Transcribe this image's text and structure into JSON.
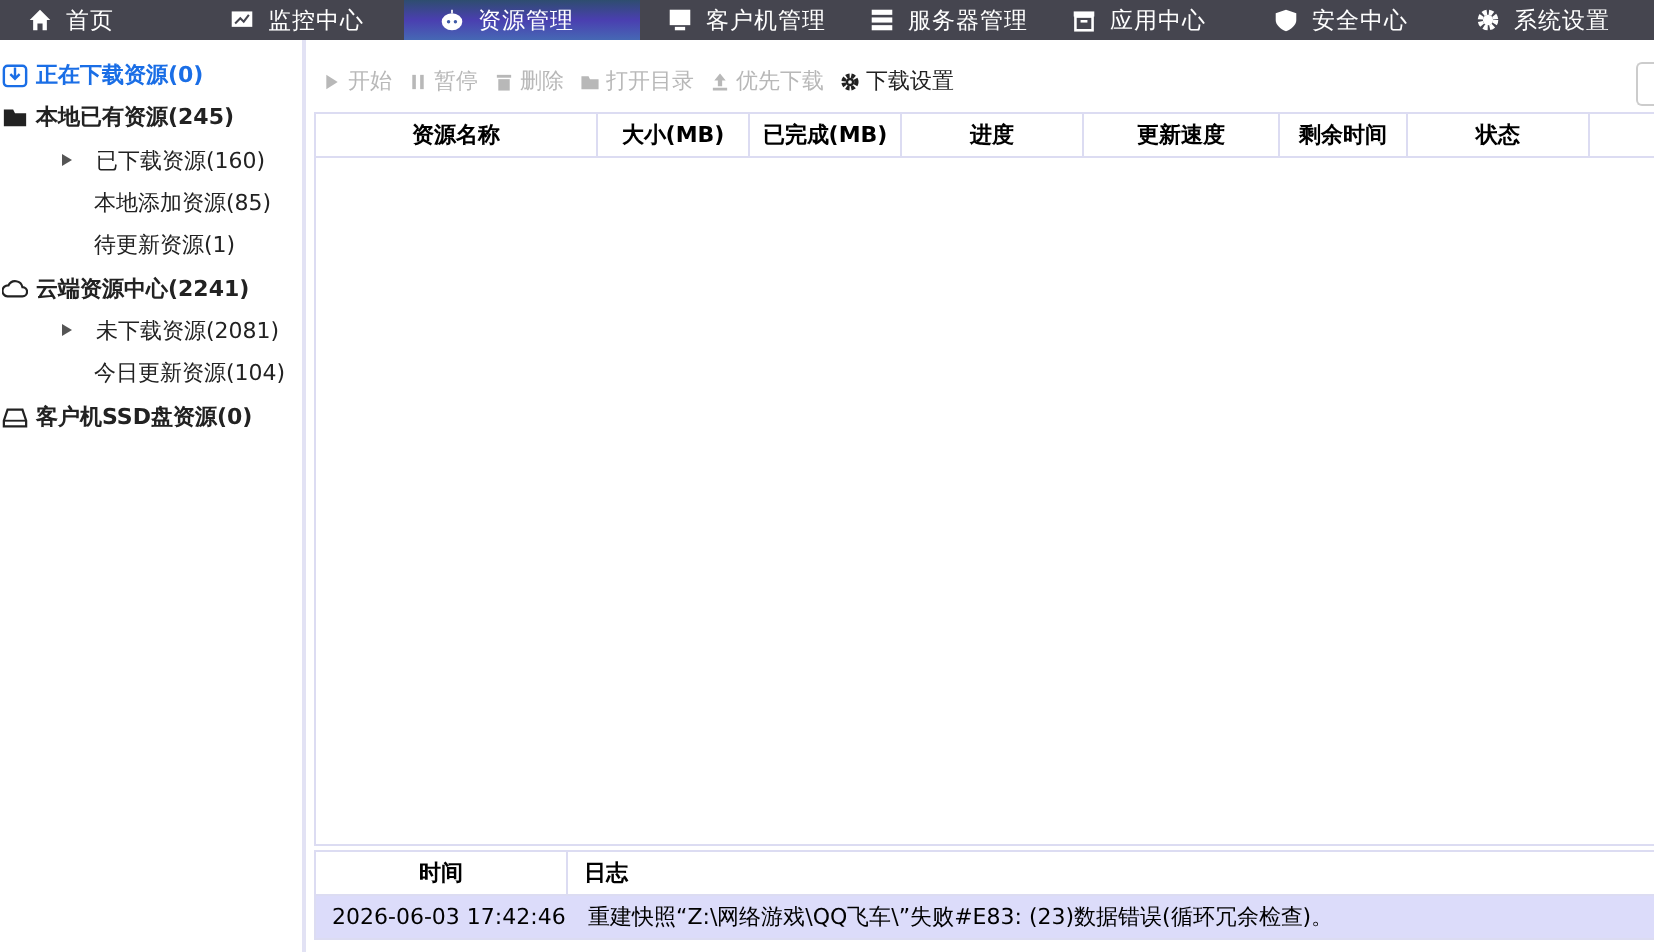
{
  "nav": {
    "tabs": [
      {
        "label": "首页",
        "kind": "home",
        "selected": false
      },
      {
        "label": "监控中心",
        "kind": "monitor",
        "selected": false
      },
      {
        "label": "资源管理",
        "kind": "robot",
        "selected": true
      },
      {
        "label": "客户机管理",
        "kind": "screen",
        "selected": false
      },
      {
        "label": "服务器管理",
        "kind": "server",
        "selected": false
      },
      {
        "label": "应用中心",
        "kind": "box",
        "selected": false
      },
      {
        "label": "安全中心",
        "kind": "shield",
        "selected": false
      },
      {
        "label": "系统设置",
        "kind": "gear",
        "selected": false
      }
    ]
  },
  "sidebar": {
    "items": [
      {
        "label": "正在下载资源(0)",
        "kind": "download",
        "selected": true
      },
      {
        "label": "本地已有资源(245)",
        "kind": "folder",
        "selected": false,
        "children": [
          {
            "label": "已下载资源(160)",
            "expanded": false,
            "selected": false
          },
          {
            "label": "本地添加资源(85)",
            "selected": false
          },
          {
            "label": "待更新资源(1)",
            "selected": false
          }
        ]
      },
      {
        "label": "云端资源中心(2241)",
        "kind": "cloud",
        "selected": false,
        "children": [
          {
            "label": "未下载资源(2081)",
            "expanded": false,
            "selected": false
          },
          {
            "label": "今日更新资源(104)",
            "selected": false
          }
        ]
      },
      {
        "label": "客户机SSD盘资源(0)",
        "kind": "drive",
        "selected": false
      }
    ]
  },
  "toolbar": {
    "buttons": [
      {
        "label": "开始",
        "kind": "play",
        "disabled": true
      },
      {
        "label": "暂停",
        "kind": "pause",
        "disabled": true
      },
      {
        "label": "删除",
        "kind": "trash",
        "disabled": true
      },
      {
        "label": "打开目录",
        "kind": "folder",
        "disabled": true
      },
      {
        "label": "优先下载",
        "kind": "upload",
        "disabled": true
      },
      {
        "label": "下载设置",
        "kind": "gear",
        "disabled": false
      }
    ]
  },
  "table": {
    "columns": [
      "资源名称",
      "大小(MB)",
      "已完成(MB)",
      "进度",
      "更新速度",
      "剩余时间",
      "状态"
    ]
  },
  "log": {
    "columns": [
      "时间",
      "日志"
    ],
    "rows": [
      {
        "time": "2026-06-03 17:42:46",
        "message": "重建快照“Z:\\网络游戏\\QQ飞车\\”失败#E83: (23)数据错误(循环冗余检查)。",
        "selected": true
      }
    ]
  }
}
